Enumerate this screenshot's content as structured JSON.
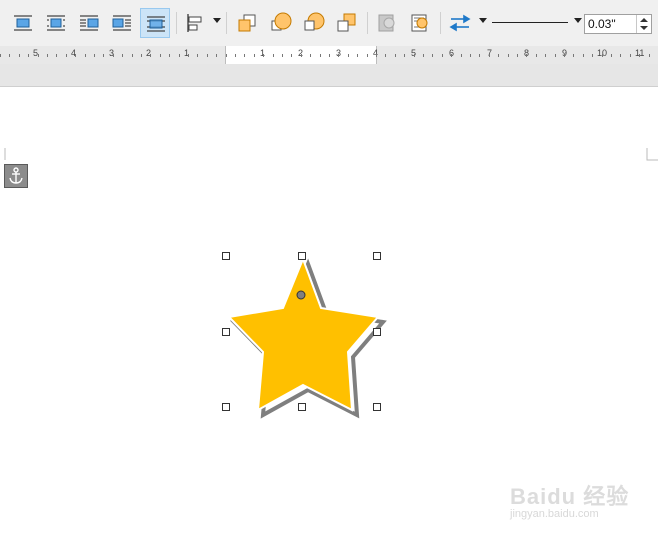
{
  "toolbar": {
    "buttons": [
      {
        "name": "wrap-off-button",
        "icon": "wrap-off-icon",
        "active": false
      },
      {
        "name": "wrap-page-button",
        "icon": "wrap-page-icon",
        "active": false
      },
      {
        "name": "wrap-left-button",
        "icon": "wrap-left-icon",
        "active": false
      },
      {
        "name": "wrap-right-button",
        "icon": "wrap-right-icon",
        "active": false
      },
      {
        "name": "wrap-through-button",
        "icon": "wrap-through-icon",
        "active": true
      },
      {
        "name": "align-objects-button",
        "icon": "align-objects-icon",
        "active": false
      },
      {
        "name": "bring-to-front-button",
        "icon": "bring-to-front-icon",
        "active": false
      },
      {
        "name": "forward-one-button",
        "icon": "forward-one-icon",
        "active": false
      },
      {
        "name": "backward-one-button",
        "icon": "backward-one-icon",
        "active": false
      },
      {
        "name": "send-to-back-button",
        "icon": "send-to-back-icon",
        "active": false
      },
      {
        "name": "to-background-button",
        "icon": "to-background-icon",
        "active": false
      },
      {
        "name": "to-foreground-button",
        "icon": "to-foreground-icon",
        "active": false
      },
      {
        "name": "arrow-style-button",
        "icon": "arrow-style-icon",
        "active": false
      }
    ],
    "line_width": "0.03\""
  },
  "ruler": {
    "labels": [
      "5",
      "4",
      "3",
      "2",
      "1",
      "1",
      "2",
      "3",
      "4",
      "5",
      "6",
      "7",
      "8",
      "9",
      "10",
      "11"
    ]
  },
  "shape": {
    "type": "star",
    "fill": "#ffc000",
    "shadow": "#7f7f7f"
  },
  "watermark": {
    "brand": "Baidu 经验",
    "url": "jingyan.baidu.com"
  }
}
